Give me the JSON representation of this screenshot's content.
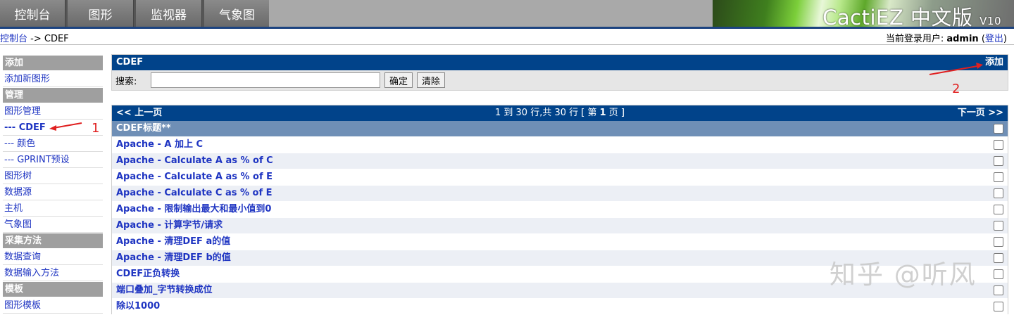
{
  "nav_tabs": [
    "控制台",
    "图形",
    "监视器",
    "气象图"
  ],
  "brand": {
    "name": "CactiEZ 中文版",
    "version": "V10"
  },
  "breadcrumb": {
    "home": "控制台",
    "sep": " -> ",
    "current": "CDEF"
  },
  "user": {
    "prefix": "当前登录用户: ",
    "name": "admin",
    "open": " (",
    "logout": "登出",
    "close": ")"
  },
  "sidebar": [
    {
      "type": "head",
      "label": "添加"
    },
    {
      "type": "item",
      "label": "添加新图形"
    },
    {
      "type": "head",
      "label": "管理"
    },
    {
      "type": "item",
      "label": "图形管理"
    },
    {
      "type": "item",
      "label": "--- CDEF",
      "active": true
    },
    {
      "type": "item",
      "label": "--- 颜色"
    },
    {
      "type": "item",
      "label": "--- GPRINT预设"
    },
    {
      "type": "item",
      "label": "图形树"
    },
    {
      "type": "item",
      "label": "数据源"
    },
    {
      "type": "item",
      "label": "主机"
    },
    {
      "type": "item",
      "label": "气象图"
    },
    {
      "type": "head",
      "label": "采集方法"
    },
    {
      "type": "item",
      "label": "数据查询"
    },
    {
      "type": "item",
      "label": "数据输入方法"
    },
    {
      "type": "head",
      "label": "模板"
    },
    {
      "type": "item",
      "label": "图形模板"
    }
  ],
  "filter": {
    "title": "CDEF",
    "add": "添加",
    "search_label": "搜索:",
    "search_value": "",
    "ok": "确定",
    "clear": "清除"
  },
  "pager": {
    "prev": "<< 上一页",
    "info_pre": "1 到 30 行,共 30 行 [ 第 ",
    "page": "1",
    "info_post": " 页 ]",
    "next": "下一页 >>"
  },
  "table": {
    "header": "CDEF标题**",
    "rows": [
      "Apache - A 加上 C",
      "Apache - Calculate A as % of C",
      "Apache - Calculate A as % of E",
      "Apache - Calculate C as % of E",
      "Apache - 限制输出最大和最小值到0",
      "Apache - 计算字节/请求",
      "Apache - 清理DEF a的值",
      "Apache - 清理DEF b的值",
      "CDEF正负转换",
      "端口叠加_字节转换成位",
      "除以1000"
    ]
  },
  "annotations": {
    "one": "1",
    "two": "2"
  },
  "watermark": "知乎 @听风",
  "colors": {
    "header_blue": "#01438a",
    "link": "#1f35c2",
    "annotation_red": "#e02020"
  }
}
